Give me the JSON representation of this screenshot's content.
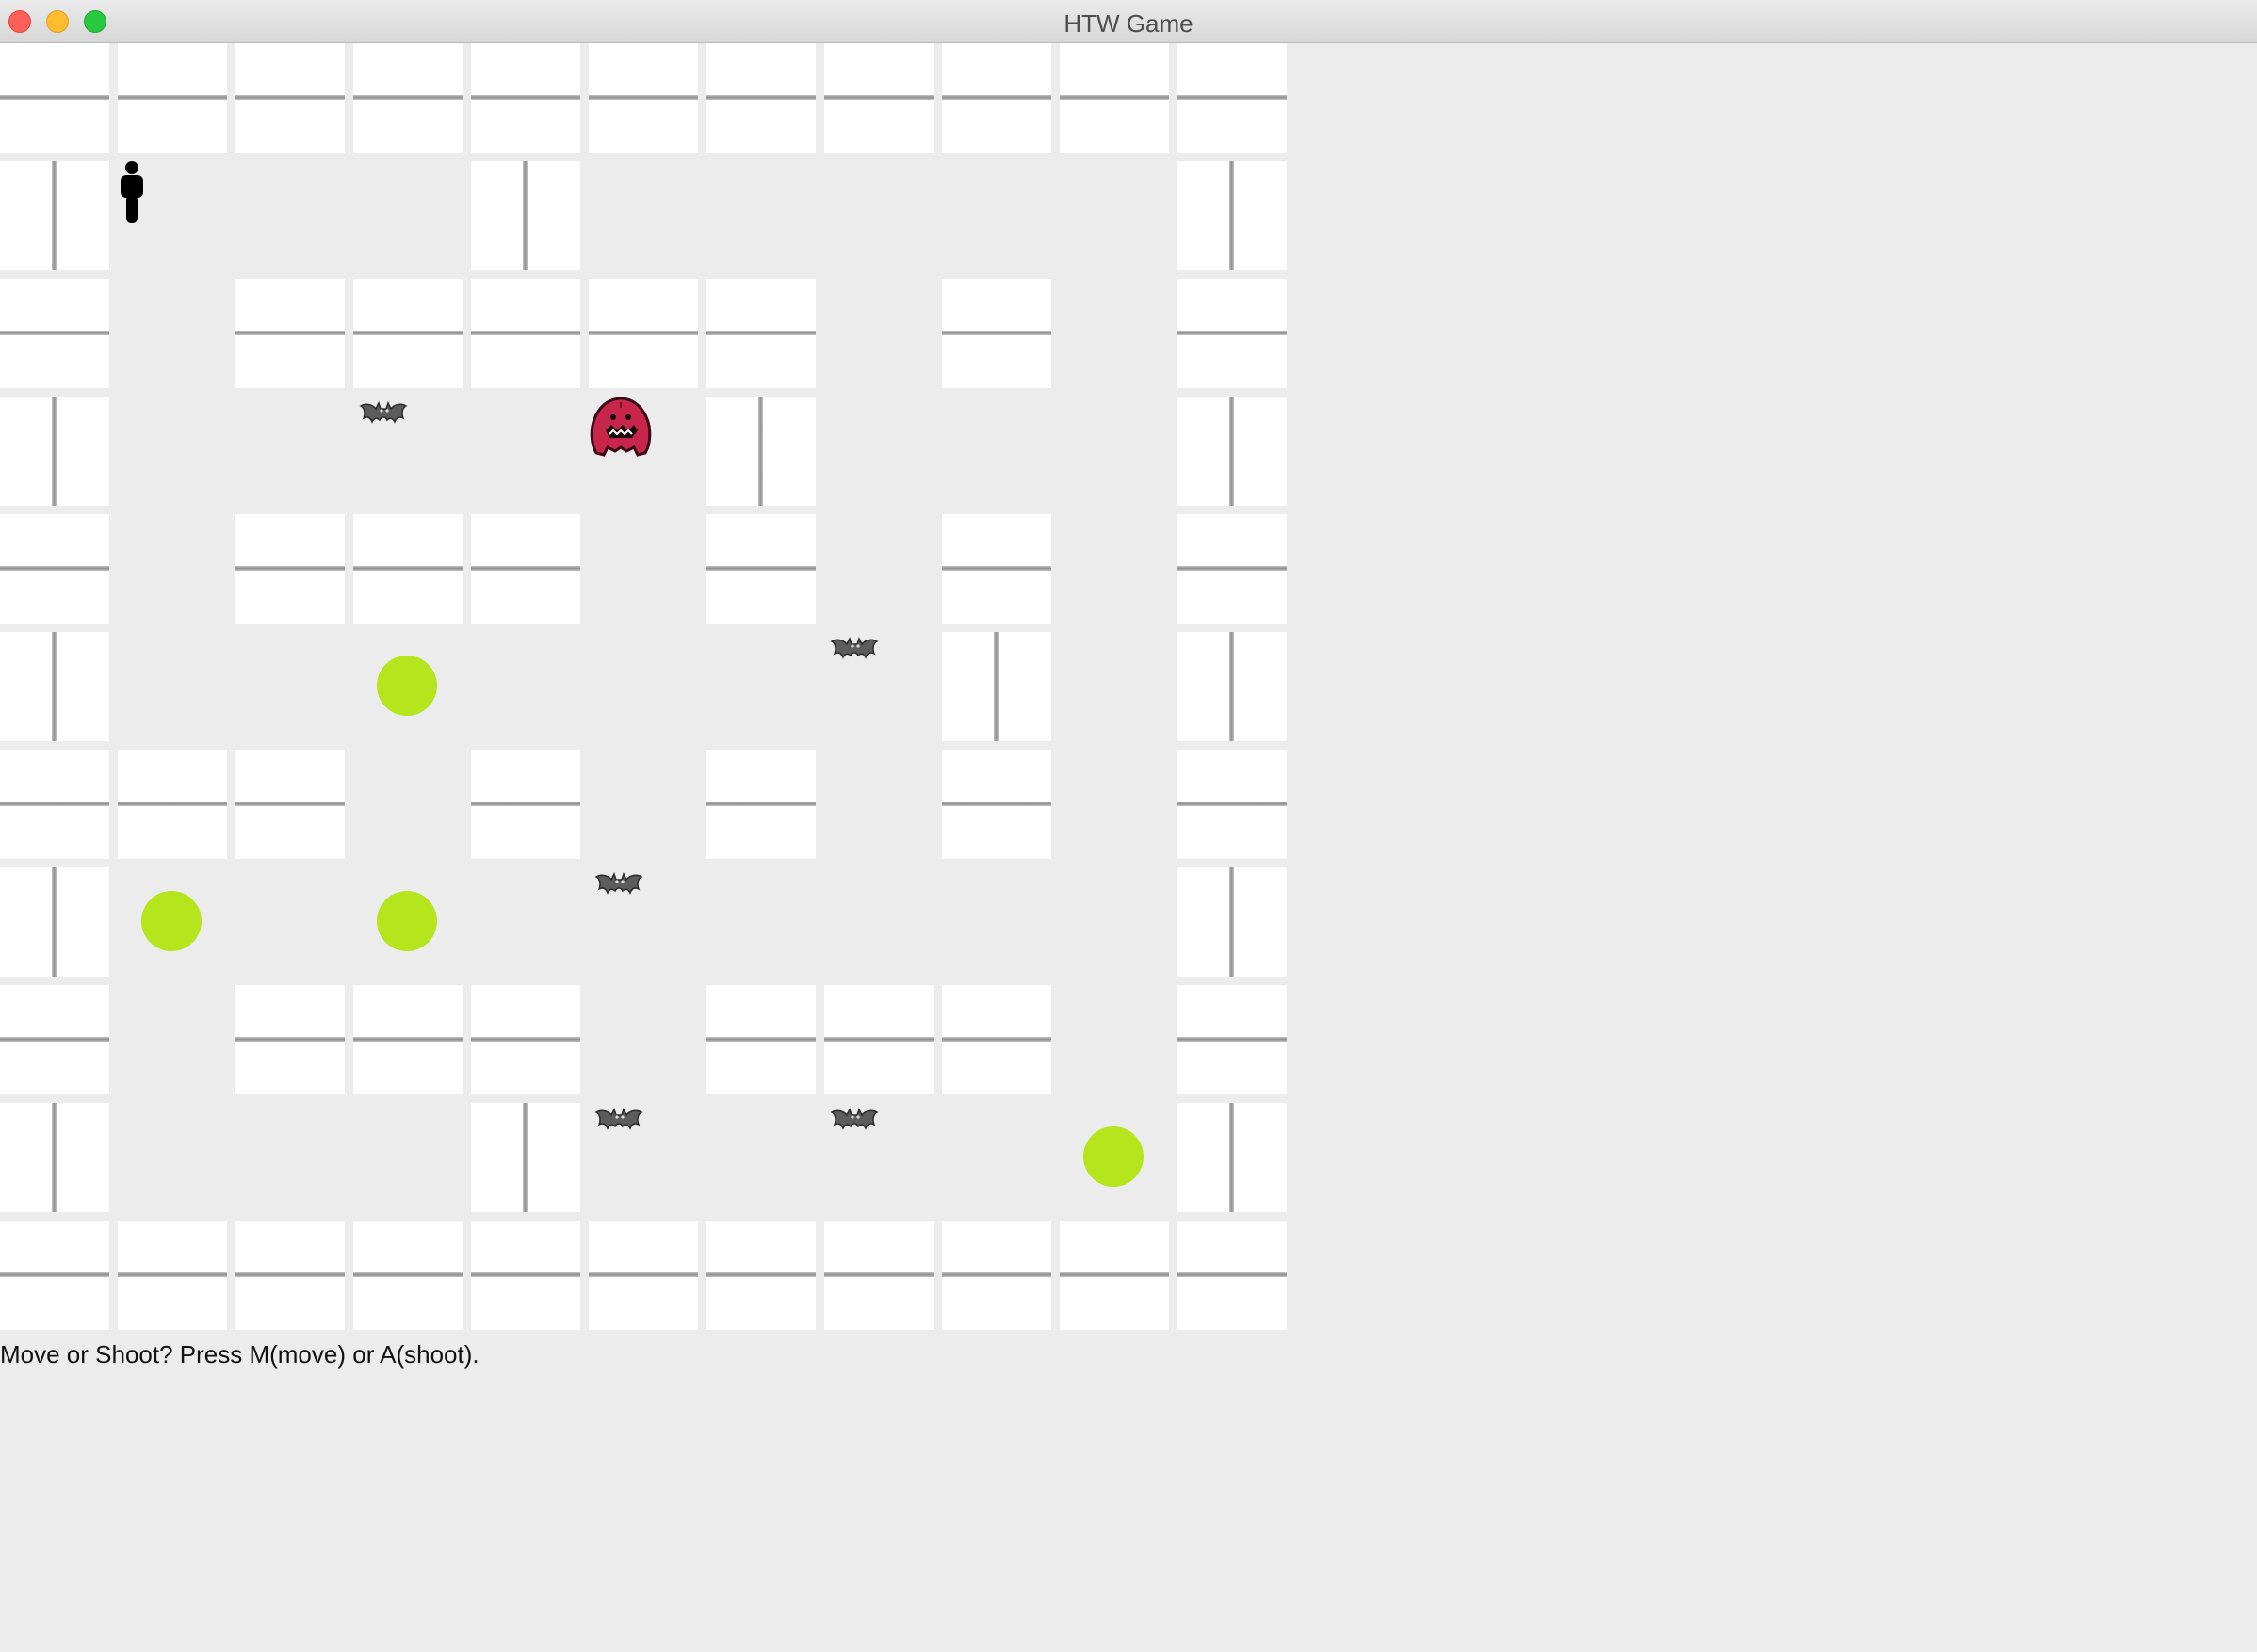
{
  "window": {
    "title": "HTW Game"
  },
  "status": {
    "message": "Move or Shoot? Press M(move) or A(shoot)."
  },
  "game": {
    "columns": 11,
    "rows": 11,
    "colors": {
      "pit": "#b5e51d",
      "wumpus": "#c8254a",
      "bat": "#5c5c5c",
      "player": "#000000",
      "tile": "#ffffff",
      "floor": "#ececec"
    },
    "tiles": [
      {
        "r": 0,
        "c": 0,
        "o": "h"
      },
      {
        "r": 0,
        "c": 1,
        "o": "h"
      },
      {
        "r": 0,
        "c": 2,
        "o": "h"
      },
      {
        "r": 0,
        "c": 3,
        "o": "h"
      },
      {
        "r": 0,
        "c": 4,
        "o": "h"
      },
      {
        "r": 0,
        "c": 5,
        "o": "h"
      },
      {
        "r": 0,
        "c": 6,
        "o": "h"
      },
      {
        "r": 0,
        "c": 7,
        "o": "h"
      },
      {
        "r": 0,
        "c": 8,
        "o": "h"
      },
      {
        "r": 0,
        "c": 9,
        "o": "h"
      },
      {
        "r": 0,
        "c": 10,
        "o": "h"
      },
      {
        "r": 1,
        "c": 0,
        "o": "v"
      },
      {
        "r": 1,
        "c": 4,
        "o": "v"
      },
      {
        "r": 1,
        "c": 10,
        "o": "v"
      },
      {
        "r": 2,
        "c": 0,
        "o": "h"
      },
      {
        "r": 2,
        "c": 2,
        "o": "h"
      },
      {
        "r": 2,
        "c": 3,
        "o": "h"
      },
      {
        "r": 2,
        "c": 4,
        "o": "h"
      },
      {
        "r": 2,
        "c": 5,
        "o": "h"
      },
      {
        "r": 2,
        "c": 6,
        "o": "h"
      },
      {
        "r": 2,
        "c": 8,
        "o": "h"
      },
      {
        "r": 2,
        "c": 10,
        "o": "h"
      },
      {
        "r": 3,
        "c": 0,
        "o": "v"
      },
      {
        "r": 3,
        "c": 6,
        "o": "v"
      },
      {
        "r": 3,
        "c": 10,
        "o": "v"
      },
      {
        "r": 4,
        "c": 0,
        "o": "h"
      },
      {
        "r": 4,
        "c": 2,
        "o": "h"
      },
      {
        "r": 4,
        "c": 3,
        "o": "h"
      },
      {
        "r": 4,
        "c": 4,
        "o": "h"
      },
      {
        "r": 4,
        "c": 6,
        "o": "h"
      },
      {
        "r": 4,
        "c": 8,
        "o": "h"
      },
      {
        "r": 4,
        "c": 10,
        "o": "h"
      },
      {
        "r": 5,
        "c": 0,
        "o": "v"
      },
      {
        "r": 5,
        "c": 8,
        "o": "v"
      },
      {
        "r": 5,
        "c": 10,
        "o": "v"
      },
      {
        "r": 6,
        "c": 0,
        "o": "h"
      },
      {
        "r": 6,
        "c": 1,
        "o": "h"
      },
      {
        "r": 6,
        "c": 2,
        "o": "h"
      },
      {
        "r": 6,
        "c": 4,
        "o": "h"
      },
      {
        "r": 6,
        "c": 6,
        "o": "h"
      },
      {
        "r": 6,
        "c": 8,
        "o": "h"
      },
      {
        "r": 6,
        "c": 10,
        "o": "h"
      },
      {
        "r": 7,
        "c": 0,
        "o": "v"
      },
      {
        "r": 7,
        "c": 10,
        "o": "v"
      },
      {
        "r": 8,
        "c": 0,
        "o": "h"
      },
      {
        "r": 8,
        "c": 2,
        "o": "h"
      },
      {
        "r": 8,
        "c": 3,
        "o": "h"
      },
      {
        "r": 8,
        "c": 4,
        "o": "h"
      },
      {
        "r": 8,
        "c": 6,
        "o": "h"
      },
      {
        "r": 8,
        "c": 7,
        "o": "h"
      },
      {
        "r": 8,
        "c": 8,
        "o": "h"
      },
      {
        "r": 8,
        "c": 10,
        "o": "h"
      },
      {
        "r": 9,
        "c": 0,
        "o": "v"
      },
      {
        "r": 9,
        "c": 4,
        "o": "v"
      },
      {
        "r": 9,
        "c": 10,
        "o": "v"
      },
      {
        "r": 10,
        "c": 0,
        "o": "h"
      },
      {
        "r": 10,
        "c": 1,
        "o": "h"
      },
      {
        "r": 10,
        "c": 2,
        "o": "h"
      },
      {
        "r": 10,
        "c": 3,
        "o": "h"
      },
      {
        "r": 10,
        "c": 4,
        "o": "h"
      },
      {
        "r": 10,
        "c": 5,
        "o": "h"
      },
      {
        "r": 10,
        "c": 6,
        "o": "h"
      },
      {
        "r": 10,
        "c": 7,
        "o": "h"
      },
      {
        "r": 10,
        "c": 8,
        "o": "h"
      },
      {
        "r": 10,
        "c": 9,
        "o": "h"
      },
      {
        "r": 10,
        "c": 10,
        "o": "h"
      }
    ],
    "player": {
      "r": 1,
      "c": 1,
      "icon": "player-icon"
    },
    "wumpus": {
      "r": 3,
      "c": 5,
      "icon": "wumpus-icon"
    },
    "bats": [
      {
        "r": 3,
        "c": 3
      },
      {
        "r": 5,
        "c": 7
      },
      {
        "r": 7,
        "c": 5
      },
      {
        "r": 9,
        "c": 5
      },
      {
        "r": 9,
        "c": 7
      }
    ],
    "pits": [
      {
        "r": 5,
        "c": 3
      },
      {
        "r": 7,
        "c": 1
      },
      {
        "r": 7,
        "c": 3
      },
      {
        "r": 9,
        "c": 9
      }
    ]
  }
}
